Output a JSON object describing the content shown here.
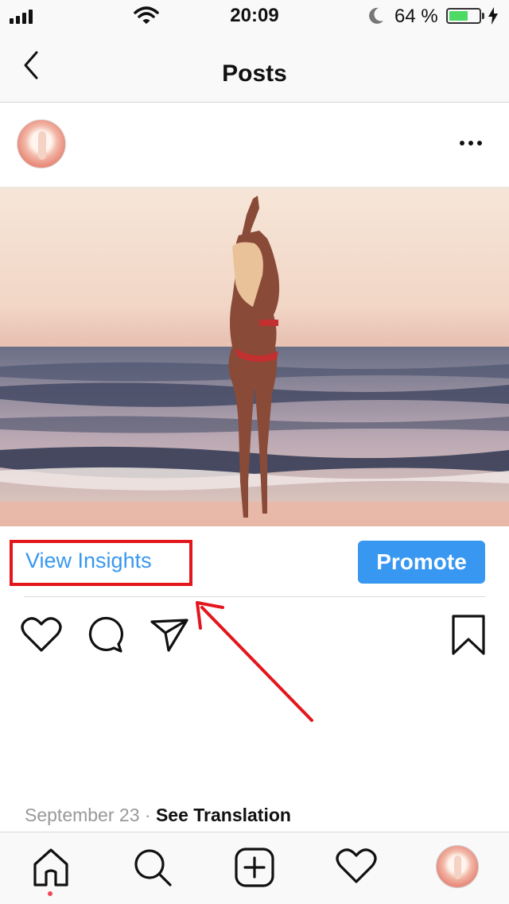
{
  "status_bar": {
    "time": "20:09",
    "battery_percent": "64 %",
    "battery_level": 0.64,
    "battery_color": "#4cd964",
    "icons": [
      "signal-icon",
      "wifi-icon",
      "moon-icon",
      "battery-icon",
      "charging-bolt-icon"
    ]
  },
  "header": {
    "title": "Posts",
    "back_icon": "chevron-left-icon"
  },
  "post": {
    "more_icon": "more-options-icon",
    "photo_description_icon": "post-photo",
    "view_insights_label": "View Insights",
    "promote_label": "Promote",
    "date": "September 23",
    "separator": "·",
    "see_translation_label": "See Translation",
    "actions": [
      "heart-icon",
      "comment-icon",
      "share-icon",
      "bookmark-icon"
    ]
  },
  "annotation": {
    "highlight_color": "#e3161c"
  },
  "tab_bar": {
    "tabs": [
      "home-icon",
      "search-icon",
      "add-post-icon",
      "activity-heart-icon",
      "profile-avatar"
    ],
    "accent_color": "#3897f0",
    "notification_dot_color": "#ed4956"
  }
}
